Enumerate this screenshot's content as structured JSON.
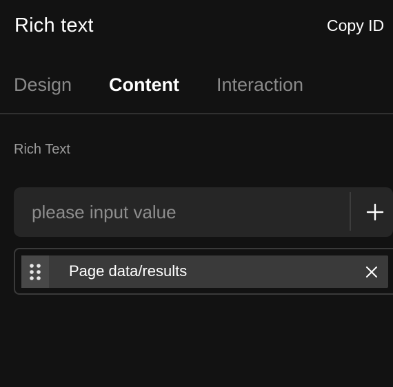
{
  "header": {
    "title": "Rich text",
    "copy_id_label": "Copy ID"
  },
  "tabs": [
    {
      "label": "Design",
      "active": false
    },
    {
      "label": "Content",
      "active": true
    },
    {
      "label": "Interaction",
      "active": false
    }
  ],
  "content": {
    "section_label": "Rich Text",
    "input": {
      "value": "",
      "placeholder": "please input value"
    },
    "add_icon": "plus-icon",
    "bindings": [
      {
        "label": "Page data/results",
        "handle_icon": "drag-handle-icon",
        "remove_icon": "close-icon"
      }
    ]
  },
  "colors": {
    "background": "#121212",
    "input_background": "#262626",
    "chip_background": "#3a3a3a",
    "muted_text": "#8a8a8a"
  }
}
